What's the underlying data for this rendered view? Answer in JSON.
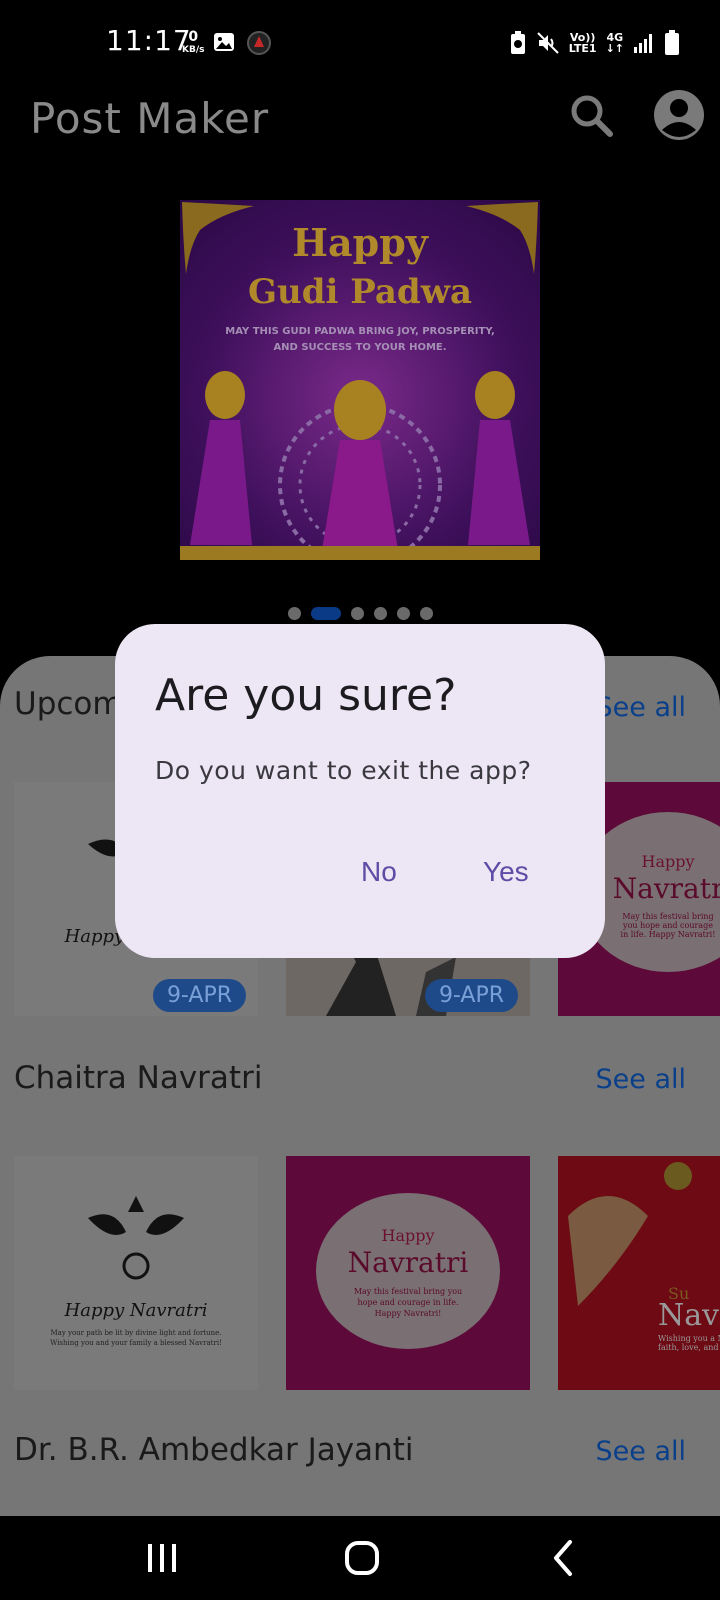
{
  "status_bar": {
    "time": "11:17",
    "net_speed_value": "0",
    "net_speed_unit": "KB/s",
    "volte": "Vo))",
    "lte": "LTE1",
    "network": "4G"
  },
  "app_bar": {
    "title": "Post Maker",
    "search_icon": "search-icon",
    "account_icon": "account-circle-icon"
  },
  "banner": {
    "line1": "Happy",
    "line2": "Gudi Padwa",
    "subtitle": "MAY THIS GUDI PADWA BRING JOY, PROSPERITY, AND SUCCESS TO YOUR HOME.",
    "page_count": 6,
    "active_page": 2
  },
  "sections": [
    {
      "title": "Upcoming",
      "see_all": "See all",
      "cards": [
        {
          "caption": "Happy Navratri",
          "badge": "9-APR"
        },
        {
          "badge": "9-APR"
        },
        {
          "line1": "Happy",
          "line2": "Navratri",
          "body": "May this festival bring you hope and courage in life. Happy Navratri!"
        }
      ]
    },
    {
      "title": "Chaitra Navratri",
      "see_all": "See all",
      "cards": [
        {
          "caption": "Happy Navratri",
          "body": "May your path be lit by divine light and fortune. Wishing you and your family a blessed Navratri!"
        },
        {
          "line1": "Happy",
          "line2": "Navratri",
          "body": "May this festival bring you hope and courage in life. Happy Navratri!"
        },
        {
          "line1": "Su",
          "line2": "Nav",
          "body": "Wishing you a N faith, love, and h"
        }
      ]
    },
    {
      "title": "Dr. B.R. Ambedkar Jayanti",
      "see_all": "See all"
    }
  ],
  "dialog": {
    "title": "Are you sure?",
    "message": "Do you want to exit the app?",
    "no_label": "No",
    "yes_label": "Yes",
    "background": "#ede6f4",
    "accent": "#5d4ca6"
  },
  "nav_bar": {
    "recents_icon": "recents-icon",
    "home_icon": "home-icon",
    "back_icon": "back-icon"
  }
}
